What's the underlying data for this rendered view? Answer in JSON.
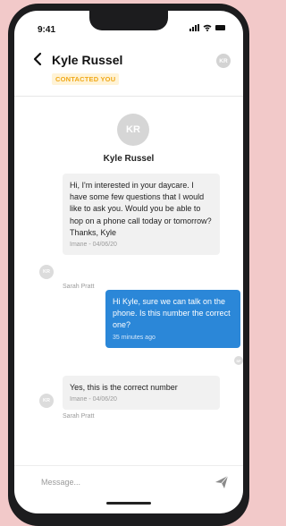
{
  "status_bar": {
    "time": "9:41"
  },
  "header": {
    "contact_name": "Kyle Russel",
    "status_tag": "CONTACTED YOU",
    "avatar_initials": "KR"
  },
  "profile": {
    "initials": "KR",
    "name": "Kyle Russel"
  },
  "messages": [
    {
      "direction": "incoming",
      "text": "Hi, I'm interested in your daycare. I have some few questions that I would like to ask you. Would you be able to hop on a phone call today or tomorrow? Thanks, Kyle",
      "meta": "Imane - 04/06/20",
      "sender": "Sarah Pratt",
      "avatar_initials": "KR"
    },
    {
      "direction": "outgoing",
      "text": "Hi Kyle, sure we can talk on the phone. Is this number the correct one?",
      "meta": "35 minutes ago",
      "avatar_initials": "SP"
    },
    {
      "direction": "incoming",
      "text": "Yes, this is the correct number",
      "meta": "Imane - 04/06/20",
      "sender": "Sarah Pratt",
      "avatar_initials": "KR"
    }
  ],
  "composer": {
    "placeholder": "Message..."
  },
  "colors": {
    "outgoing_bubble": "#2b87d8",
    "incoming_bubble": "#f1f1f1",
    "tag_text": "#f0a818",
    "tag_bg": "#fff3d6"
  }
}
